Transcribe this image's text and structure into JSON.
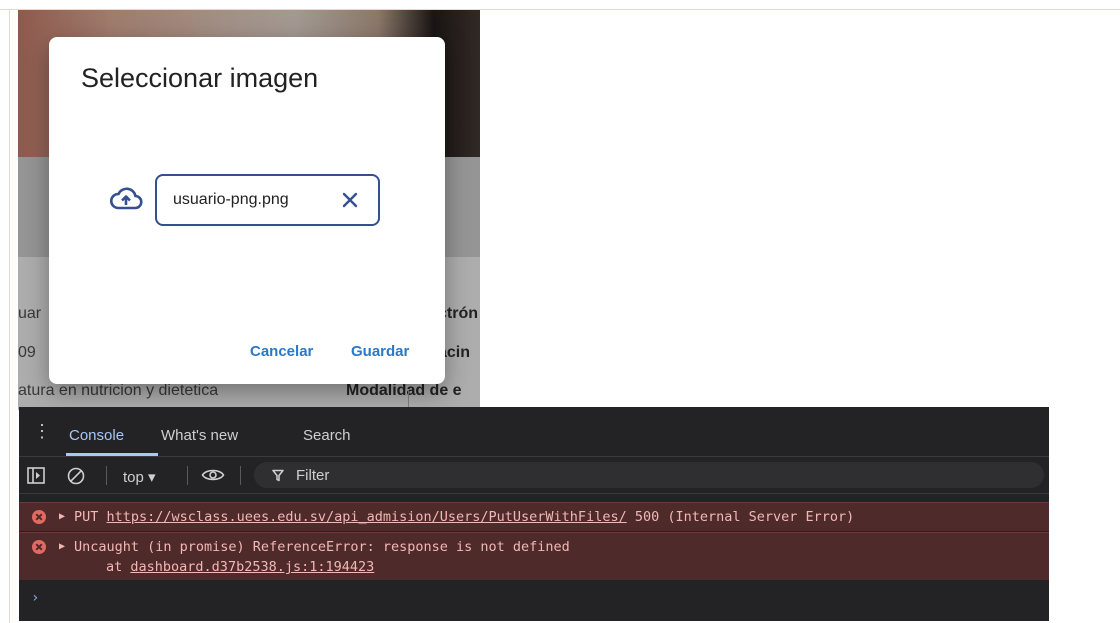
{
  "background_page": {
    "row1_left": "uar",
    "row1_right": "ctrón",
    "row2_left": "09",
    "row2_right": "acin",
    "row3_left": "atura en nutricion y dietetica",
    "row3_right": "Modalidad de e"
  },
  "dialog": {
    "title": "Seleccionar imagen",
    "file_name": "usuario-png.png",
    "cancel_label": "Cancelar",
    "save_label": "Guardar"
  },
  "devtools": {
    "tabs": [
      "Console",
      "What's new",
      "Search"
    ],
    "context": "top ▾",
    "filter_placeholder": "Filter",
    "messages": [
      {
        "method": "PUT",
        "url": "https://wsclass.uees.edu.sv/api_admision/Users/PutUserWithFiles/",
        "status": "500 (Internal Server Error)"
      },
      {
        "text": "Uncaught (in promise) ReferenceError: response is not defined",
        "at_prefix": "at",
        "at_link": "dashboard.d37b2538.js:1:194423"
      }
    ],
    "prompt": "›"
  },
  "colors": {
    "accent": "#2a78c6",
    "chip_border": "#35508f",
    "devtools_bg": "#232325",
    "error_bg": "#4e2a2a",
    "error_text": "#f2b8b5"
  }
}
